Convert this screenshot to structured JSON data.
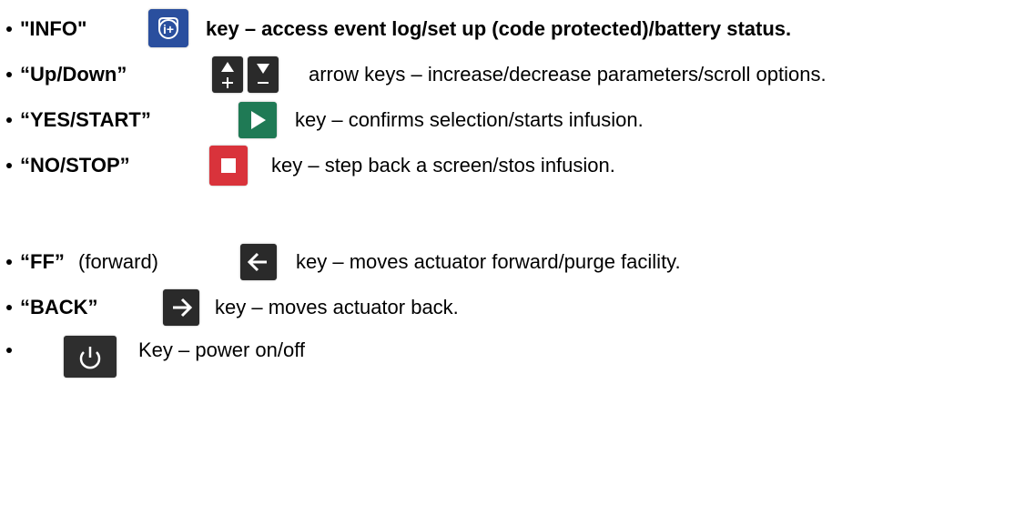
{
  "rows": [
    {
      "label": "\"INFO\"",
      "description": "key – access event log/set up (code protected)/battery status.",
      "icon": "info-plus-icon",
      "color": "#2a4f9e"
    },
    {
      "label": "“Up/Down”",
      "description": "arrow keys – increase/decrease parameters/scroll options.",
      "icon": "up-plus-down-minus-icons",
      "color": "#2a2a2a"
    },
    {
      "label": "“YES/START”",
      "description": "key – confirms selection/starts infusion.",
      "icon": "play-icon",
      "color": "#1f7a55"
    },
    {
      "label": "“NO/STOP”",
      "description": "key – step back a screen/stos infusion.",
      "icon": "stop-icon",
      "color": "#d9333b"
    },
    {
      "label": "“FF”",
      "note": "(forward)",
      "description": "key – moves actuator forward/purge facility.",
      "icon": "arrow-left-icon",
      "color": "#2a2a2a"
    },
    {
      "label": "“BACK”",
      "description": "key – moves actuator back.",
      "icon": "arrow-right-icon",
      "color": "#2a2a2a"
    },
    {
      "label": "",
      "description": "Key – power on/off",
      "icon": "power-icon",
      "color": "#2e2e2e"
    }
  ]
}
